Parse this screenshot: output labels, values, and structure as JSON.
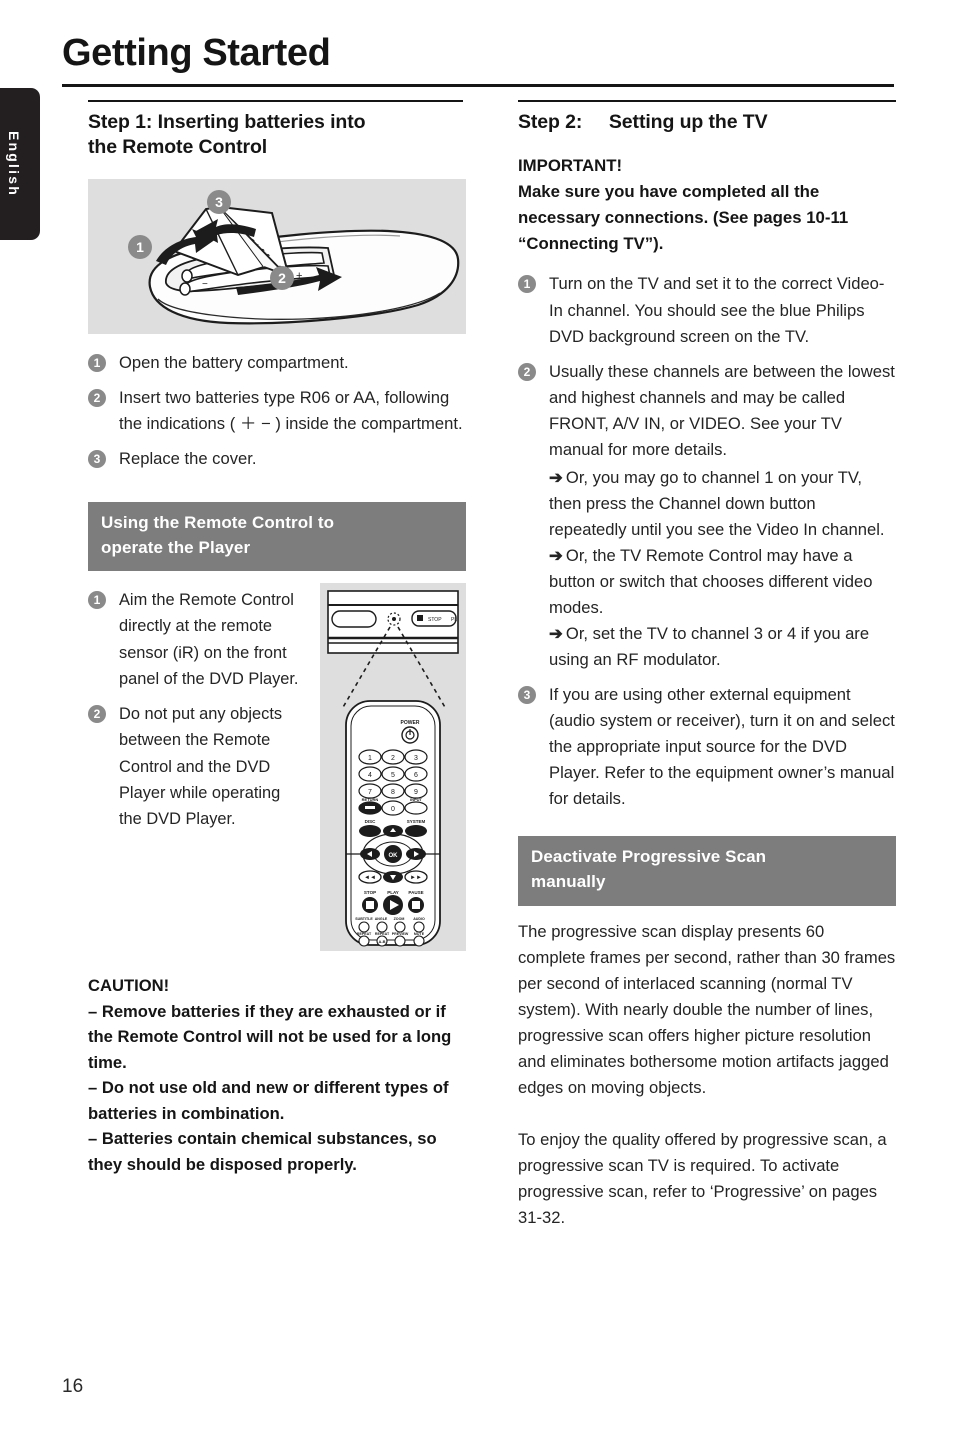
{
  "language_tab": "English",
  "page_title": "Getting Started",
  "page_number": "16",
  "left_column": {
    "step1_heading": "Step 1:  Inserting batteries into\nthe Remote Control",
    "battery_figure": {
      "name": "battery-compartment-illustration",
      "callouts": [
        "1",
        "2",
        "3"
      ],
      "polarity_marks": [
        "+",
        "+"
      ],
      "background": "#dedede"
    },
    "battery_steps": [
      {
        "num": "1",
        "text": "Open the battery compartment."
      },
      {
        "num": "2",
        "text": "Insert two batteries type R06 or AA, following the indications ( ＋ − ) inside the compartment."
      },
      {
        "num": "3",
        "text": "Replace the cover."
      }
    ],
    "remote_band": "Using the Remote Control to\noperate the Player",
    "remote_steps": [
      {
        "num": "1",
        "text": "Aim the Remote Control directly at the remote sensor (iR) on the front panel of the DVD Player."
      },
      {
        "num": "2",
        "text": "Do not put any objects between the Remote Control and the DVD Player while operating the DVD Player."
      }
    ],
    "remote_figure": {
      "name": "remote-control-aiming-illustration",
      "background": "#dedede",
      "player_front_label": "STOP",
      "power_label": "POWER",
      "keypad": [
        "1",
        "2",
        "3",
        "4",
        "5",
        "6",
        "7",
        "8",
        "9",
        "0"
      ],
      "side_labels": [
        "RETURN",
        "INPUT",
        "DISC",
        "SYSTEM"
      ],
      "transport_labels": [
        "STOP",
        "PLAY",
        "PAUSE"
      ],
      "ok_label": "OK",
      "bottom_row1": [
        "SUBTITLE",
        "ANGLE",
        "ZOOM",
        "AUDIO"
      ],
      "bottom_row2": [
        "REPEAT",
        "REPEAT A-B",
        "PREVIEW",
        "MUTE"
      ],
      "ab_label": "A-B"
    },
    "caution": {
      "title": "CAUTION!",
      "items": [
        "–  Remove batteries if they are exhausted or if the Remote Control will not be used for a long time.",
        "–  Do not use old and new or different types of batteries in combination.",
        "–  Batteries contain chemical substances, so they should be disposed properly."
      ]
    }
  },
  "right_column": {
    "step2_heading": "Step 2:     Setting up the TV",
    "important": {
      "title": "IMPORTANT!",
      "text": "Make sure you have completed all the necessary connections. (See pages 10-11 “Connecting TV”)."
    },
    "tv_steps": [
      {
        "num": "1",
        "text": "Turn on the TV and set it to the correct Video-In channel. You should see the blue Philips DVD background screen on the TV."
      },
      {
        "num": "2",
        "text": "Usually these channels are between the lowest and highest channels and may be called FRONT, A/V IN, or VIDEO. See your TV manual for more details.",
        "arrows": [
          "Or, you may go to channel 1 on your TV, then press the Channel down button repeatedly until you see the Video In channel.",
          "Or, the TV Remote Control may have a button or switch that chooses different video modes.",
          "Or, set the TV to channel 3 or 4 if you are using an RF modulator."
        ]
      },
      {
        "num": "3",
        "text": "If you are using other external equipment (audio system or receiver), turn it on and select the appropriate input source for the DVD Player. Refer to the equipment owner’s manual for details."
      }
    ],
    "progressive_band": "Deactivate Progressive Scan\nmanually",
    "progressive_paragraph1": "The progressive scan display presents 60 complete frames per second, rather than 30 frames per second of interlaced scanning (normal TV system). With nearly double the number of lines, progressive scan offers higher picture resolution and eliminates bothersome motion artifacts jagged edges on moving objects.",
    "progressive_paragraph2": "To enjoy the quality offered by progressive scan, a progressive scan TV is required. To activate progressive scan, refer to ‘Progressive’ on pages 31-32."
  },
  "colors": {
    "band_gray": "#7d7d7d",
    "figure_gray": "#dedede",
    "bullet_gray": "#8a8a8a",
    "tab_black": "#231f20"
  }
}
